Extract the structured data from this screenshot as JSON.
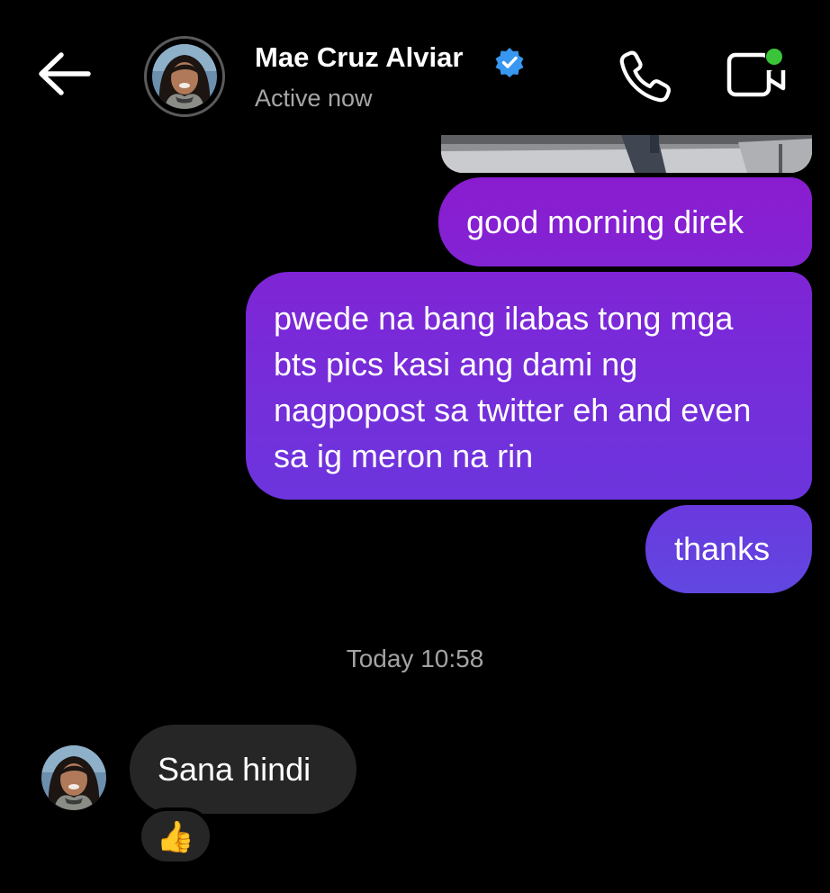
{
  "header": {
    "contact_name": "Mae Cruz Alviar",
    "status": "Active now",
    "verified": true,
    "online_dot_color": "#3ac43a",
    "verified_color": "#3897f0"
  },
  "conversation": {
    "outgoing": [
      {
        "text": "good morning direk"
      },
      {
        "text": "pwede na bang ilabas tong mga bts pics kasi ang dami ng nagpopost sa twitter eh and even sa ig meron na rin"
      },
      {
        "text": "thanks"
      }
    ],
    "timestamp": "Today 10:58",
    "incoming": [
      {
        "text": "Sana hindi",
        "reaction": "👍"
      }
    ]
  },
  "colors": {
    "background": "#000000",
    "outgoing_bubble_top": "#8a1ccf",
    "outgoing_bubble_bottom": "#6147e0",
    "incoming_bubble": "#262626",
    "secondary_text": "#a6a6a6"
  },
  "icons": {
    "back": "back-arrow-icon",
    "call": "phone-icon",
    "video": "video-camera-icon",
    "verified": "verified-badge-icon"
  }
}
